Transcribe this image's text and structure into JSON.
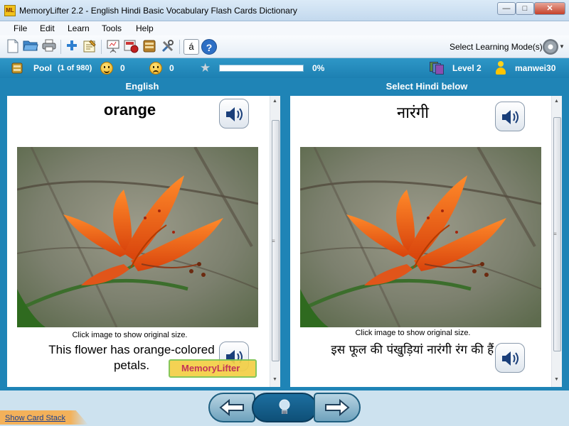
{
  "window": {
    "app_icon": "ML",
    "title": "MemoryLifter 2.2 - English Hindi Basic Vocabulary Flash Cards Dictionary",
    "minimize_icon": "minimize-icon",
    "maximize_icon": "maximize-icon",
    "close_icon": "close-icon",
    "minimize_glyph": "—",
    "maximize_glyph": "□",
    "close_glyph": "✕"
  },
  "menu": [
    "File",
    "Edit",
    "Learn",
    "Tools",
    "Help"
  ],
  "toolbar": {
    "icons": [
      "new-file-icon",
      "open-folder-icon",
      "print-icon",
      "add-card-icon",
      "edit-card-icon",
      "presentation-icon",
      "card-settings-icon",
      "card-stack-icon",
      "tools-icon",
      "character-map-icon",
      "help-icon"
    ],
    "char_map_glyph": "á",
    "help_glyph": "?",
    "mode_label": "Select Learning Mode(s)",
    "mode_icon": "gear-icon"
  },
  "status": {
    "pool_label": "Pool",
    "pool_count": "(1 of 980)",
    "right_count": "0",
    "wrong_count": "0",
    "progress_fraction": 0.0,
    "progress_text": "0%",
    "level": "Level 2",
    "user": "manwei30",
    "colors": {
      "bar": "#1d80b2",
      "text": "#ffffff",
      "progress": "#5fc05f"
    }
  },
  "question": {
    "header": "English",
    "word": "orange",
    "caption": "Click image to show original size.",
    "sentence": "This flower has orange-colored petals."
  },
  "answer": {
    "header": "Select Hindi below",
    "word": "नारंगी",
    "caption": "Click image to show original size.",
    "sentence": "इस फूल की पंखुड़ियां नारंगी रंग की हैं।"
  },
  "watermark": "MemoryLifter",
  "navigation": {
    "prev_icon": "arrow-left-icon",
    "hint_icon": "lightbulb-icon",
    "next_icon": "arrow-right-icon"
  },
  "card_stack_link": "Show Card Stack"
}
